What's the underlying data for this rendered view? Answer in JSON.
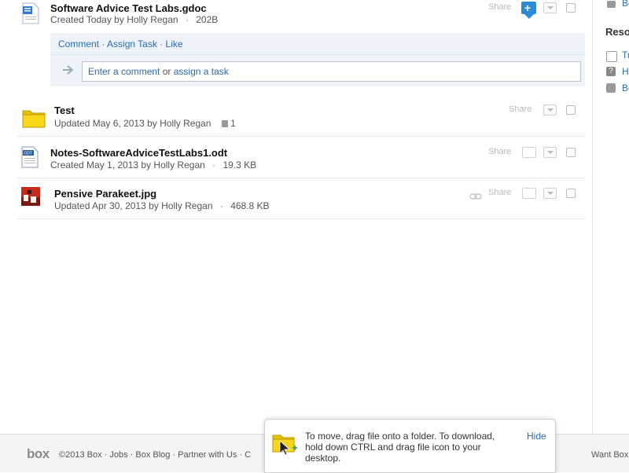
{
  "files": [
    {
      "name": "Software Advice Test Labs.gdoc",
      "meta_prefix": "Created Today by",
      "user": "Holly Regan",
      "size": "202B",
      "share": "Share",
      "icon": "gdoc-file-icon"
    },
    {
      "name": "Test",
      "meta_prefix": "Updated May 6, 2013 by",
      "user": "Holly Regan",
      "count": "1",
      "share": "Share",
      "icon": "folder-icon"
    },
    {
      "name": "Notes-SoftwareAdviceTestLabs1.odt",
      "meta_prefix": "Created May 1, 2013 by",
      "user": "Holly Regan",
      "size": "19.3 KB",
      "share": "Share",
      "icon": "odt-file-icon"
    },
    {
      "name": "Pensive Parakeet.jpg",
      "meta_prefix": "Updated Apr 30, 2013 by",
      "user": "Holly Regan",
      "size": "468.8 KB",
      "share": "Share",
      "icon": "jpg-thumbnail-icon"
    }
  ],
  "actions": {
    "comment": "Comment",
    "assign": "Assign Task",
    "like": "Like",
    "sep": "·"
  },
  "comment_box": {
    "part1": "Enter a comment",
    "or": "or",
    "part2": "assign a task"
  },
  "sidebar": {
    "top_label": "Be",
    "heading": "Reso",
    "items": [
      "Tr",
      "H",
      "Be"
    ]
  },
  "tip": {
    "text": "To move, drag file onto a folder. To download, hold down CTRL and drag file icon to your desktop.",
    "hide": "Hide"
  },
  "footer": {
    "logo": "box",
    "links": "©2013 Box  ·  Jobs  ·  Box Blog  ·  Partner with Us  ·  C",
    "right": "Want Box"
  },
  "colors": {
    "accent": "#2a6bb3",
    "panel": "#eef3f9",
    "action_btn": "#2d8bd6"
  }
}
